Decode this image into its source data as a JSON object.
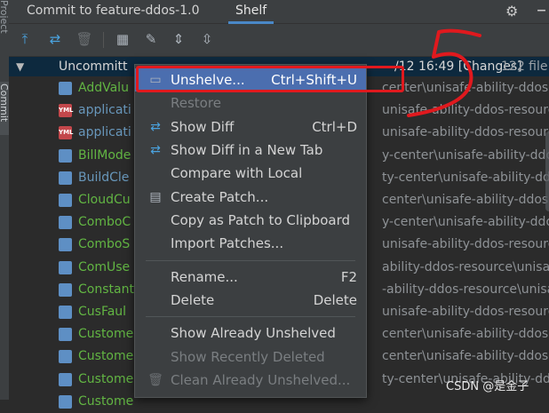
{
  "sidebar": {
    "project_label": "Project",
    "commit_label": "Commit"
  },
  "header": {
    "tab_commit": "Commit to feature-ddos-1.0",
    "tab_shelf": "Shelf",
    "settings_icon": "gear-icon",
    "minimize_icon": "minimize-icon"
  },
  "toolbar": {
    "icons": [
      "unshelve-icon",
      "show-diff-icon",
      "delete-icon",
      "group-by-icon",
      "show-already-unshelved-icon",
      "expand-all-icon",
      "collapse-all-icon"
    ]
  },
  "tree": {
    "shelf_title": "Uncommitt",
    "shelf_date": "/12 16:49 [Changes]",
    "shelf_count": "122 file",
    "files": [
      {
        "name": "AddValu",
        "type": "java",
        "color": "green",
        "path": "center\\unisafe-ability-ddos-resou"
      },
      {
        "name": "applicati",
        "type": "yml",
        "color": "blue",
        "path": "unisafe-ability-ddos-resource\\"
      },
      {
        "name": "applicati",
        "type": "yml",
        "color": "blue",
        "path": "unisafe-ability-ddos-resource\\"
      },
      {
        "name": "BillMode",
        "type": "java",
        "color": "green",
        "path": "y-center\\unisafe-ability-ddos"
      },
      {
        "name": "BuildCle",
        "type": "java",
        "color": "blue",
        "path": "ty-center\\unisafe-ability-ddo"
      },
      {
        "name": "CloudCu",
        "type": "java",
        "color": "green",
        "path": "center\\unisafe-ability-ddos-re"
      },
      {
        "name": "ComboC",
        "type": "java",
        "color": "green",
        "path": "y-center\\unisafe-ability-ddos"
      },
      {
        "name": "ComboS",
        "type": "java",
        "color": "green",
        "path": "unisafe-ability-ddos-resource"
      },
      {
        "name": "ComUse",
        "type": "java",
        "color": "green",
        "path": "ability-ddos-resource\\unisafe"
      },
      {
        "name": "Constant",
        "type": "java",
        "color": "green",
        "path": "-ability-ddos-resource\\unisafe"
      },
      {
        "name": "CusFaul",
        "type": "java",
        "color": "green",
        "path": "unisafe-ability-ddos-resource"
      },
      {
        "name": "Custome",
        "type": "java",
        "color": "green",
        "path": "center\\unisafe-ability-ddos-re"
      },
      {
        "name": "Custome",
        "type": "java",
        "color": "green",
        "path": "center\\unisafe-ability-ddos-re"
      },
      {
        "name": "Custome",
        "type": "java",
        "color": "green",
        "path": "ty-center\\unisafe-ability-dd"
      },
      {
        "name": "Custome",
        "type": "java",
        "color": "green",
        "path": ""
      }
    ]
  },
  "context_menu": {
    "items": [
      {
        "label": "Unshelve...",
        "shortcut": "Ctrl+Shift+U",
        "icon": "unshelve-icon",
        "state": "highlighted"
      },
      {
        "label": "Restore",
        "shortcut": "",
        "icon": "",
        "state": "disabled"
      },
      {
        "label": "Show Diff",
        "shortcut": "Ctrl+D",
        "icon": "diff-icon",
        "state": "normal"
      },
      {
        "label": "Show Diff in a New Tab",
        "shortcut": "",
        "icon": "diff-icon",
        "state": "normal"
      },
      {
        "label": "Compare with Local",
        "shortcut": "",
        "icon": "",
        "state": "normal"
      },
      {
        "label": "Create Patch...",
        "shortcut": "",
        "icon": "patch-icon",
        "state": "normal"
      },
      {
        "label": "Copy as Patch to Clipboard",
        "shortcut": "",
        "icon": "",
        "state": "normal"
      },
      {
        "label": "Import Patches...",
        "shortcut": "",
        "icon": "",
        "state": "normal"
      },
      {
        "label": "Rename...",
        "shortcut": "F2",
        "icon": "",
        "state": "normal"
      },
      {
        "label": "Delete",
        "shortcut": "Delete",
        "icon": "",
        "state": "normal"
      },
      {
        "label": "Show Already Unshelved",
        "shortcut": "",
        "icon": "",
        "state": "normal"
      },
      {
        "label": "Show Recently Deleted",
        "shortcut": "",
        "icon": "",
        "state": "disabled"
      },
      {
        "label": "Clean Already Unshelved...",
        "shortcut": "",
        "icon": "trash-icon",
        "state": "disabled"
      }
    ]
  },
  "watermark": "CSDN @是金子",
  "colors": {
    "highlight": "#4b6eaf",
    "annotation_red": "#e0191e",
    "selected_row": "#0d293e"
  }
}
